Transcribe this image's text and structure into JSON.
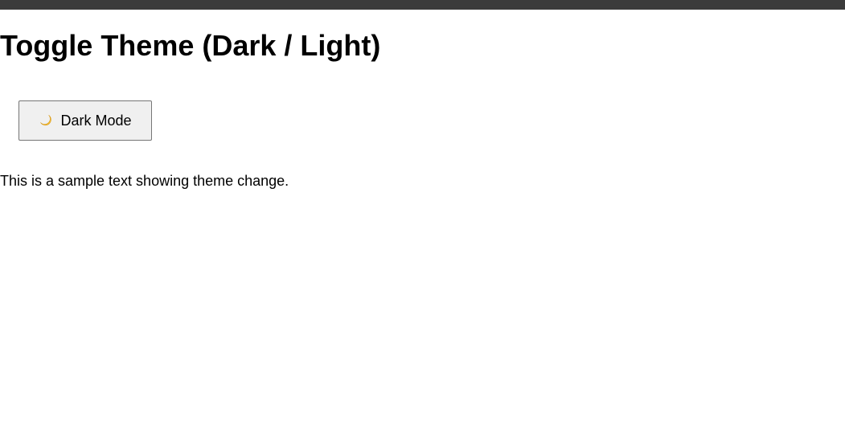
{
  "page": {
    "title": "Toggle Theme (Dark / Light)",
    "sample_text": "This is a sample text showing theme change."
  },
  "theme_toggle": {
    "icon": "moon-icon",
    "label": "Dark Mode"
  },
  "colors": {
    "top_bar": "#3b3b3b",
    "background": "#ffffff",
    "text": "#000000",
    "button_background": "#f0f0f0",
    "button_border": "#767676",
    "moon": "#f7c33a"
  }
}
